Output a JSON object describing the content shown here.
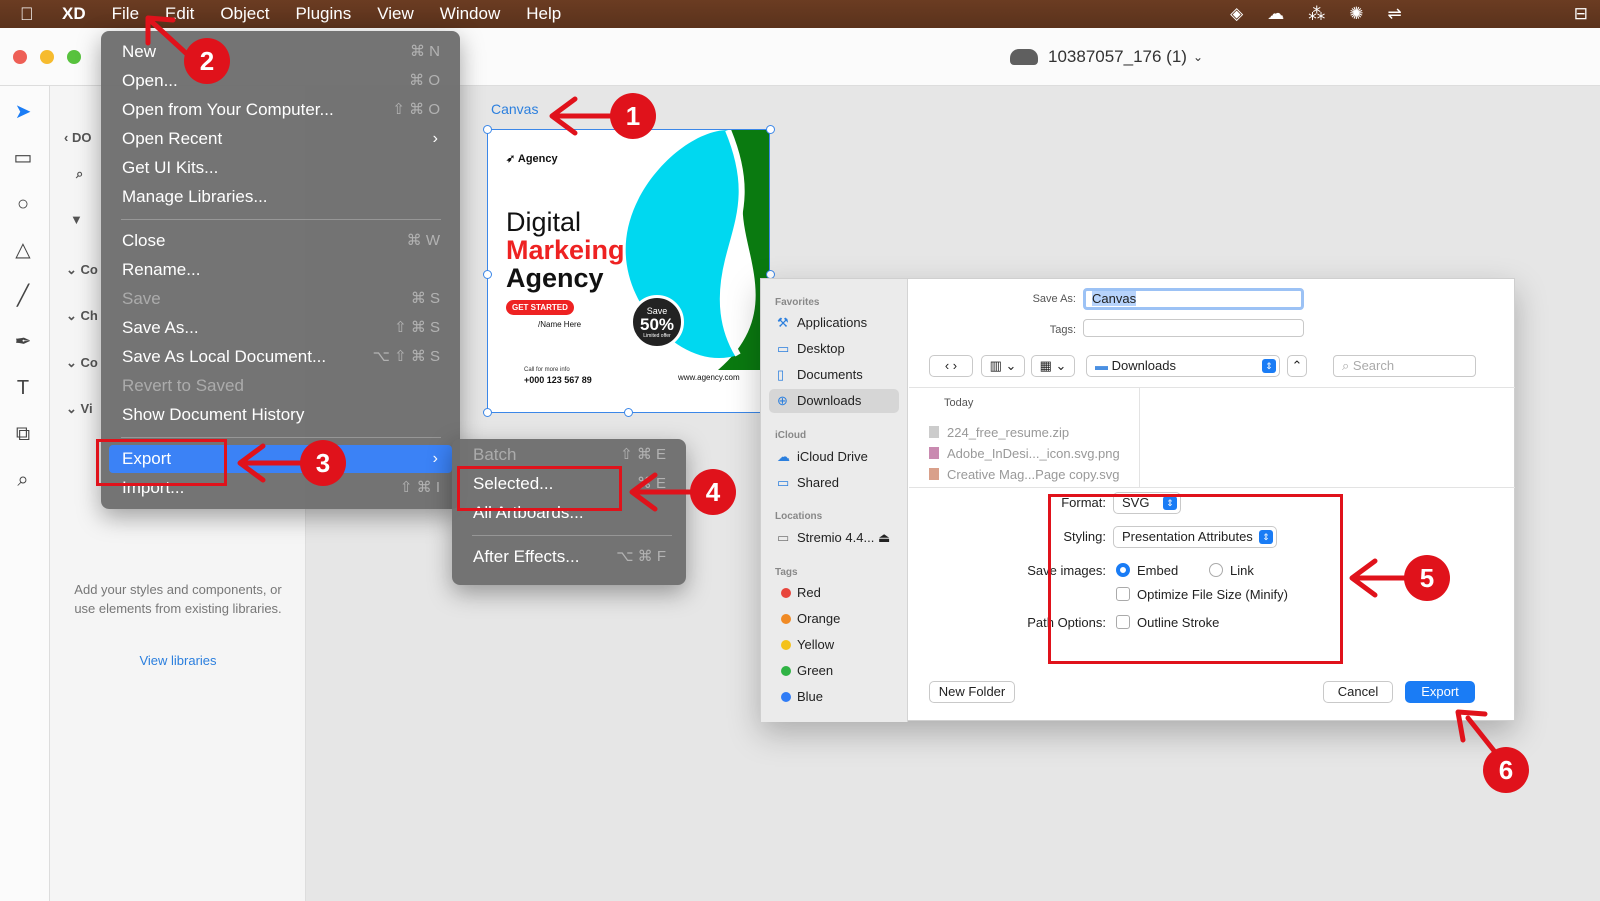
{
  "menubar": {
    "app_name": "XD",
    "items": [
      "File",
      "Edit",
      "Object",
      "Plugins",
      "View",
      "Window",
      "Help"
    ]
  },
  "window": {
    "doc_title": "10387057_176 (1)"
  },
  "left_panel": {
    "rows": [
      "DO",
      "Co",
      "Ch",
      "Co",
      "Vi"
    ],
    "empty_message": "Add your styles and components, or use elements from existing libraries.",
    "view_libraries": "View libraries"
  },
  "artboard": {
    "label": "Canvas",
    "brand": "Agency",
    "headline_1": "Digital",
    "headline_2": "Markeing",
    "headline_3": "Agency",
    "cta": "GET STARTED",
    "name": "/Name Here",
    "call_text": "Call for more info",
    "phone": "+000 123 567 89",
    "website": "www.agency.com",
    "save_top": "Save",
    "save_value": "50%",
    "save_bottom": "Limited offer"
  },
  "file_menu": {
    "items": [
      {
        "label": "New",
        "shortcut": "⌘ N"
      },
      {
        "label": "Open...",
        "shortcut": "⌘ O"
      },
      {
        "label": "Open from Your Computer...",
        "shortcut": "⇧ ⌘ O"
      },
      {
        "label": "Open Recent",
        "shortcut": "›"
      },
      {
        "label": "Get UI Kits...",
        "shortcut": ""
      },
      {
        "label": "Manage Libraries...",
        "shortcut": ""
      },
      {
        "label": "Close",
        "shortcut": "⌘ W"
      },
      {
        "label": "Rename...",
        "shortcut": ""
      },
      {
        "label": "Save",
        "shortcut": "⌘ S"
      },
      {
        "label": "Save As...",
        "shortcut": "⇧ ⌘ S"
      },
      {
        "label": "Save As Local Document...",
        "shortcut": "⌥ ⇧ ⌘ S"
      },
      {
        "label": "Revert to Saved",
        "shortcut": ""
      },
      {
        "label": "Show Document History",
        "shortcut": ""
      },
      {
        "label": "Export",
        "shortcut": "›"
      },
      {
        "label": "Import...",
        "shortcut": "⇧ ⌘ I"
      }
    ]
  },
  "export_submenu": {
    "items": [
      {
        "label": "Batch",
        "shortcut": "⇧ ⌘ E"
      },
      {
        "label": "Selected...",
        "shortcut": "⌘ E"
      },
      {
        "label": "All Artboards...",
        "shortcut": ""
      },
      {
        "label": "After Effects...",
        "shortcut": "⌥ ⌘ F"
      }
    ]
  },
  "save_dialog": {
    "sidebar": {
      "favorites_head": "Favorites",
      "favorites": [
        "Applications",
        "Desktop",
        "Documents",
        "Downloads"
      ],
      "icloud_head": "iCloud",
      "icloud": [
        "iCloud Drive",
        "Shared"
      ],
      "locations_head": "Locations",
      "locations": [
        "Stremio 4.4..."
      ],
      "tags_head": "Tags",
      "tags": [
        {
          "label": "Red",
          "color": "#e8453c"
        },
        {
          "label": "Orange",
          "color": "#f08a24"
        },
        {
          "label": "Yellow",
          "color": "#f4c21b"
        },
        {
          "label": "Green",
          "color": "#2fb344"
        },
        {
          "label": "Blue",
          "color": "#2f7cf6"
        }
      ]
    },
    "save_as_label": "Save As:",
    "save_as_value": "Canvas",
    "tags_label": "Tags:",
    "location": "Downloads",
    "search_placeholder": "Search",
    "today_label": "Today",
    "files": [
      "224_free_resume.zip",
      "Adobe_InDesi..._icon.svg.png",
      "Creative Mag...Page copy.svg"
    ],
    "format_label": "Format:",
    "format_value": "SVG",
    "styling_label": "Styling:",
    "styling_value": "Presentation Attributes",
    "save_images_label": "Save images:",
    "embed_label": "Embed",
    "link_label": "Link",
    "optimize_label": "Optimize File Size (Minify)",
    "path_options_label": "Path Options:",
    "outline_label": "Outline Stroke",
    "new_folder": "New Folder",
    "cancel": "Cancel",
    "export": "Export"
  },
  "annotations": [
    "1",
    "2",
    "3",
    "4",
    "5",
    "6"
  ],
  "colors": {
    "annotation_red": "#e0121b",
    "accent_blue": "#1a7cf5",
    "artboard_cyan": "#00d8f0",
    "artboard_green": "#0a7a10"
  }
}
